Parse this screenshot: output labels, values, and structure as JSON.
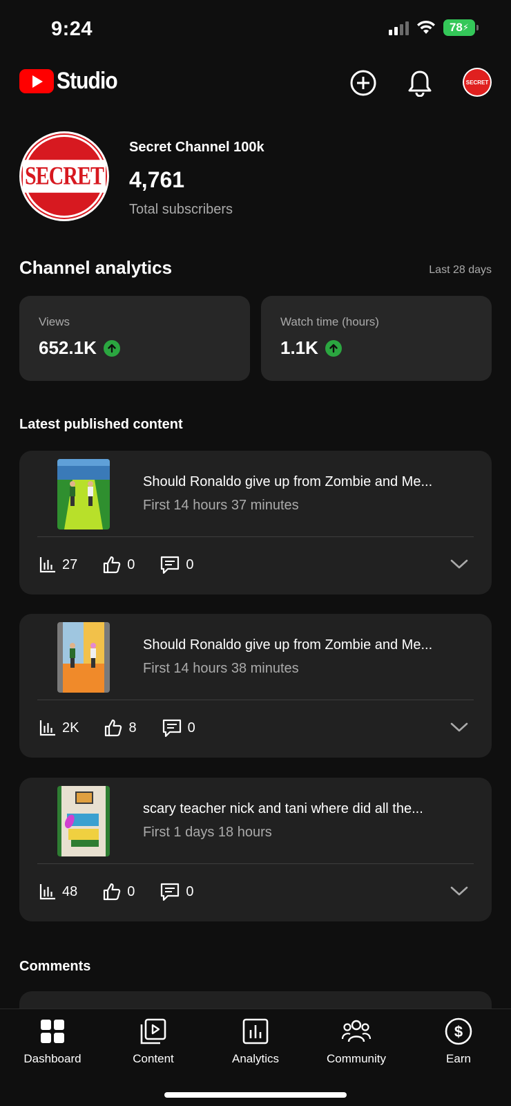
{
  "status_bar": {
    "time": "9:24",
    "battery": "78"
  },
  "app": {
    "brand": "Studio",
    "avatar_text": "SECRET"
  },
  "channel": {
    "name": "Secret Channel 100k",
    "subscribers": "4,761",
    "subscribers_label": "Total subscribers",
    "avatar_text": "SECRET"
  },
  "analytics": {
    "title": "Channel analytics",
    "range": "Last 28 days",
    "metrics": [
      {
        "label": "Views",
        "value": "652.1K",
        "trend": "up"
      },
      {
        "label": "Watch time (hours)",
        "value": "1.1K",
        "trend": "up"
      }
    ]
  },
  "latest": {
    "title": "Latest published content",
    "items": [
      {
        "title": "Should Ronaldo give up from Zombie and Me...",
        "subtitle": "First 14 hours 37 minutes",
        "views": "27",
        "likes": "0",
        "comments": "0"
      },
      {
        "title": "Should Ronaldo give up from Zombie and Me...",
        "subtitle": "First 14 hours 38 minutes",
        "views": "2K",
        "likes": "8",
        "comments": "0"
      },
      {
        "title": "scary teacher nick and tani where did all the...",
        "subtitle": "First 1 days 18 hours",
        "views": "48",
        "likes": "0",
        "comments": "0"
      }
    ]
  },
  "comments": {
    "title": "Comments"
  },
  "nav": {
    "items": [
      {
        "label": "Dashboard",
        "icon": "dashboard-icon"
      },
      {
        "label": "Content",
        "icon": "content-icon"
      },
      {
        "label": "Analytics",
        "icon": "analytics-icon"
      },
      {
        "label": "Community",
        "icon": "community-icon"
      },
      {
        "label": "Earn",
        "icon": "earn-icon"
      }
    ]
  },
  "colors": {
    "background": "#0f0f0f",
    "card": "#272727",
    "accent_red": "#ff0000",
    "trend_green": "#2ba640"
  }
}
